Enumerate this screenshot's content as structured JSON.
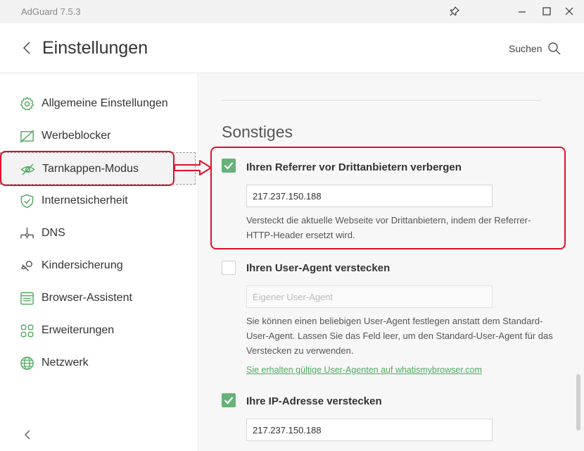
{
  "window": {
    "title": "AdGuard 7.5.3"
  },
  "header": {
    "title": "Einstellungen",
    "search_label": "Suchen"
  },
  "sidebar": {
    "items": [
      {
        "label": "Allgemeine Einstellungen",
        "icon": "gear-icon"
      },
      {
        "label": "Werbeblocker",
        "icon": "ad-block-icon"
      },
      {
        "label": "Tarnkappen-Modus",
        "icon": "eye-slash-icon",
        "active": true
      },
      {
        "label": "Internetsicherheit",
        "icon": "shield-check-icon"
      },
      {
        "label": "DNS",
        "icon": "dns-network-icon"
      },
      {
        "label": "Kindersicherung",
        "icon": "pacifier-icon"
      },
      {
        "label": "Browser-Assistent",
        "icon": "browser-window-icon"
      },
      {
        "label": "Erweiterungen",
        "icon": "extensions-grid-icon"
      },
      {
        "label": "Netzwerk",
        "icon": "globe-icon"
      }
    ]
  },
  "main": {
    "section_title": "Sonstiges",
    "options": [
      {
        "title": "Ihren Referrer vor Drittanbietern verbergen",
        "checked": true,
        "value": "217.237.150.188",
        "description": "Versteckt die aktuelle Webseite vor Drittanbietern, indem der Referrer-HTTP-Header ersetzt wird."
      },
      {
        "title": "Ihren User-Agent verstecken",
        "checked": false,
        "placeholder": "Eigener User-Agent",
        "description": "Sie können einen beliebigen User-Agent festlegen anstatt dem Standard-User-Agent. Lassen Sie das Feld leer, um den Standard-User-Agent für das Verstecken zu verwenden.",
        "link": "Sie erhalten gültige User-Agenten auf whatismybrowser.com"
      },
      {
        "title": "Ihre IP-Adresse verstecken",
        "checked": true,
        "value": "217.237.150.188"
      }
    ]
  },
  "colors": {
    "accent": "#67b279",
    "annotation": "#e0102b"
  }
}
